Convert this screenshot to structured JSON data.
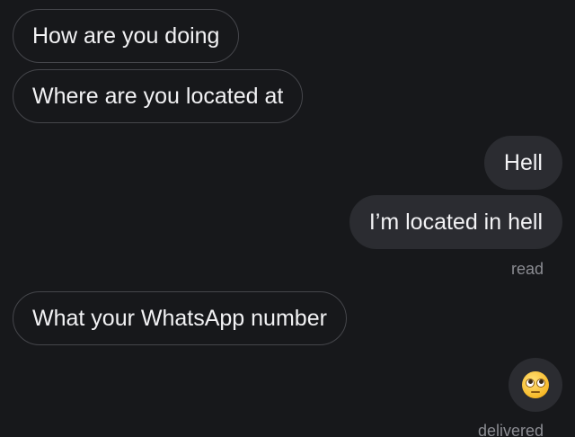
{
  "conversation": {
    "messages": [
      {
        "direction": "incoming",
        "text": "How are you doing"
      },
      {
        "direction": "incoming",
        "text": "Where are you located at"
      },
      {
        "direction": "outgoing",
        "text": "Hell"
      },
      {
        "direction": "outgoing",
        "text": "I’m located in hell"
      },
      {
        "direction": "incoming",
        "text": "What your WhatsApp number"
      },
      {
        "direction": "outgoing",
        "emoji": "face-with-rolling-eyes"
      }
    ],
    "read_status": "read",
    "delivered_status": "delivered"
  },
  "colors": {
    "background": "#17181b",
    "incoming_border": "#45464b",
    "outgoing_bubble": "#2b2c31",
    "text": "#f2f2f4",
    "status_text": "#8b8c92"
  }
}
